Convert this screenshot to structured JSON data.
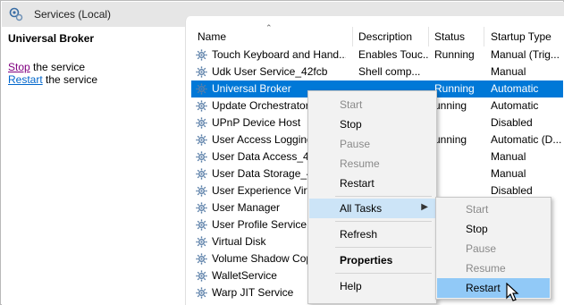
{
  "window": {
    "title": "Services (Local)"
  },
  "left_pane": {
    "service_name": "Universal Broker",
    "actions": [
      {
        "link": "Stop",
        "rest": " the service"
      },
      {
        "link": "Restart",
        "rest": " the service"
      }
    ]
  },
  "columns": [
    "Name",
    "Description",
    "Status",
    "Startup Type"
  ],
  "rows": [
    {
      "name": "Touch Keyboard and Hand...",
      "desc": "Enables Touc...",
      "status": "Running",
      "startup": "Manual (Trig..."
    },
    {
      "name": "Udk User Service_42fcb",
      "desc": "Shell comp...",
      "status": "",
      "startup": "Manual"
    },
    {
      "name": "Universal Broker",
      "desc": "",
      "status": "Running",
      "startup": "Automatic"
    },
    {
      "name": "Update Orchestrator",
      "desc": "",
      "status": "unning",
      "startup": "Automatic"
    },
    {
      "name": "UPnP Device Host",
      "desc": "",
      "status": "",
      "startup": "Disabled"
    },
    {
      "name": "User Access Logging",
      "desc": "",
      "status": "unning",
      "startup": "Automatic (D..."
    },
    {
      "name": "User Data Access_42",
      "desc": "",
      "status": "",
      "startup": "Manual"
    },
    {
      "name": "User Data Storage_42",
      "desc": "",
      "status": "",
      "startup": "Manual"
    },
    {
      "name": "User Experience Virtu",
      "desc": "",
      "status": "",
      "startup": "Disabled"
    },
    {
      "name": "User Manager",
      "desc": "",
      "status": "",
      "startup": ""
    },
    {
      "name": "User Profile Service",
      "desc": "",
      "status": "",
      "startup": ""
    },
    {
      "name": "Virtual Disk",
      "desc": "",
      "status": "",
      "startup": ""
    },
    {
      "name": "Volume Shadow Cop",
      "desc": "",
      "status": "",
      "startup": ""
    },
    {
      "name": "WalletService",
      "desc": "",
      "status": "",
      "startup": ""
    },
    {
      "name": "Warp JIT Service",
      "desc": "",
      "status": "",
      "startup": ""
    }
  ],
  "context_menu": {
    "start": "Start",
    "stop": "Stop",
    "pause": "Pause",
    "resume": "Resume",
    "restart": "Restart",
    "all_tasks": "All Tasks",
    "refresh": "Refresh",
    "properties": "Properties",
    "help": "Help"
  },
  "submenu": {
    "start": "Start",
    "stop": "Stop",
    "pause": "Pause",
    "resume": "Resume",
    "restart": "Restart"
  },
  "icons": {
    "window": "services-icon",
    "service": "gear-icon",
    "submenu_arrow": "chevron-right-icon",
    "sort": "sort-up-arrow"
  },
  "colors": {
    "selection": "#0078d7",
    "menu_highlight": "#cce4f7",
    "menu_pressed": "#91c9f7",
    "link": "#0066cc",
    "link_visited": "#800080"
  }
}
